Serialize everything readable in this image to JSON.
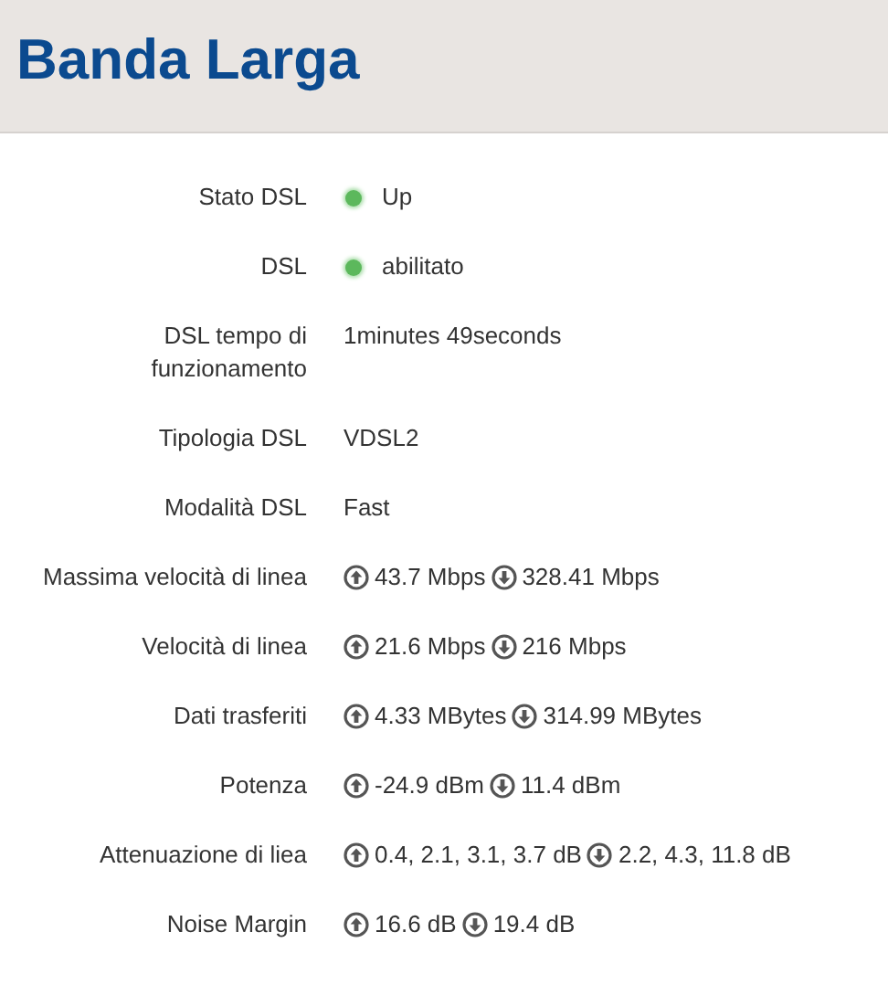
{
  "header": {
    "title": "Banda Larga"
  },
  "rows": [
    {
      "kind": "status",
      "label": "Stato DSL",
      "on": true,
      "value": "Up"
    },
    {
      "kind": "status",
      "label": "DSL",
      "on": true,
      "value": "abilitato"
    },
    {
      "kind": "text",
      "label": "DSL tempo di funzionamento",
      "value": "1minutes 49seconds"
    },
    {
      "kind": "text",
      "label": "Tipologia DSL",
      "value": "VDSL2"
    },
    {
      "kind": "text",
      "label": "Modalità DSL",
      "value": "Fast"
    },
    {
      "kind": "updown",
      "label": "Massima velocità di linea",
      "up": "43.7 Mbps",
      "down": "328.41 Mbps"
    },
    {
      "kind": "updown",
      "label": "Velocità di linea",
      "up": "21.6 Mbps",
      "down": "216 Mbps"
    },
    {
      "kind": "updown",
      "label": "Dati trasferiti",
      "up": "4.33 MBytes",
      "down": "314.99 MBytes"
    },
    {
      "kind": "updown",
      "label": "Potenza",
      "up": "-24.9 dBm",
      "down": "11.4 dBm"
    },
    {
      "kind": "updown",
      "label": "Attenuazione di liea",
      "up": "0.4, 2.1, 3.1, 3.7 dB",
      "down": "2.2, 4.3, 11.8 dB"
    },
    {
      "kind": "updown",
      "label": "Noise Margin",
      "up": "16.6 dB",
      "down": "19.4 dB"
    }
  ]
}
